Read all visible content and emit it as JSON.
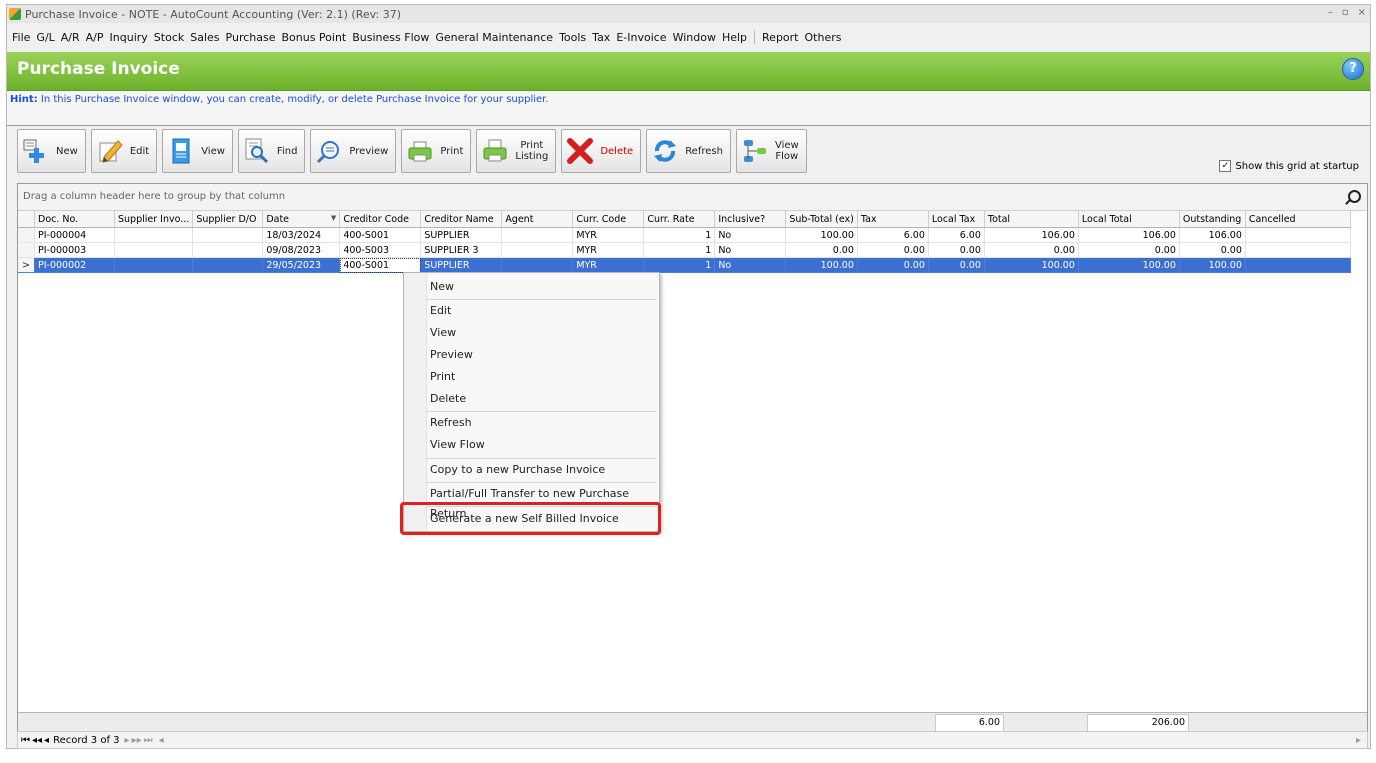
{
  "window": {
    "title": "Purchase Invoice - NOTE - AutoCount Accounting (Ver: 2.1) (Rev: 37)",
    "controls": [
      "–",
      "▫",
      "×"
    ]
  },
  "menubar": [
    "File",
    "G/L",
    "A/R",
    "A/P",
    "Inquiry",
    "Stock",
    "Sales",
    "Purchase",
    "Bonus Point",
    "Business Flow",
    "General Maintenance",
    "Tools",
    "Tax",
    "E-Invoice",
    "Window",
    "Help",
    "Report",
    "Others"
  ],
  "banner": {
    "title": "Purchase Invoice",
    "help": "?"
  },
  "hint": {
    "label": "Hint:",
    "text": " In this Purchase Invoice window, you can create, modify, or delete Purchase Invoice for your supplier."
  },
  "toolbar": {
    "new": "New",
    "edit": "Edit",
    "view": "View",
    "find": "Find",
    "preview": "Preview",
    "print": "Print",
    "print_listing_1": "Print",
    "print_listing_2": "Listing",
    "delete": "Delete",
    "refresh": "Refresh",
    "view_flow_1": "View",
    "view_flow_2": "Flow"
  },
  "startup": {
    "label": "Show this grid at startup",
    "checked": "✓"
  },
  "grid": {
    "group_hint": "Drag a column header here to group by that column",
    "columns": [
      "Doc. No.",
      "Supplier Invo...",
      "Supplier D/O",
      "Date",
      "Creditor Code",
      "Creditor Name",
      "Agent",
      "Curr. Code",
      "Curr. Rate",
      "Inclusive?",
      "Sub-Total (ex)",
      "Tax",
      "Local Tax",
      "Total",
      "Local Total",
      "Outstanding",
      "Cancelled"
    ],
    "rows": [
      [
        "PI-000004",
        "",
        "",
        "18/03/2024",
        "400-S001",
        "SUPPLIER",
        "",
        "MYR",
        "1",
        "No",
        "100.00",
        "6.00",
        "6.00",
        "106.00",
        "106.00",
        "106.00",
        ""
      ],
      [
        "PI-000003",
        "",
        "",
        "09/08/2023",
        "400-S003",
        "SUPPLIER 3",
        "",
        "MYR",
        "1",
        "No",
        "0.00",
        "0.00",
        "0.00",
        "0.00",
        "0.00",
        "0.00",
        ""
      ],
      [
        "PI-000002",
        "",
        "",
        "29/05/2023",
        "400-S001",
        "SUPPLIER",
        "",
        "MYR",
        "1",
        "No",
        "100.00",
        "0.00",
        "0.00",
        "100.00",
        "100.00",
        "100.00",
        ""
      ]
    ],
    "selected_indicator": ">",
    "footer_local_tax": "6.00",
    "footer_local_total": "206.00"
  },
  "nav": {
    "first": "⏮",
    "prev_page": "◂◂",
    "prev": "◂",
    "record": "Record 3 of 3",
    "next": "▸",
    "next_page": "▸▸",
    "last": "⏭",
    "scroll_left": "◂",
    "scroll_right": "▸"
  },
  "context_menu": {
    "new": "New",
    "edit": "Edit",
    "view": "View",
    "preview": "Preview",
    "print": "Print",
    "delete": "Delete",
    "refresh": "Refresh",
    "view_flow": "View Flow",
    "copy": "Copy to a new Purchase Invoice",
    "transfer": "Partial/Full Transfer to new Purchase Return",
    "self_billed": "Generate a new Self Billed Invoice"
  },
  "colors": {
    "banner_green": "#7cc03a",
    "selection_blue": "#3b6fd2",
    "highlight_red": "#e41d1d",
    "hint_blue": "#1a4fd6"
  }
}
